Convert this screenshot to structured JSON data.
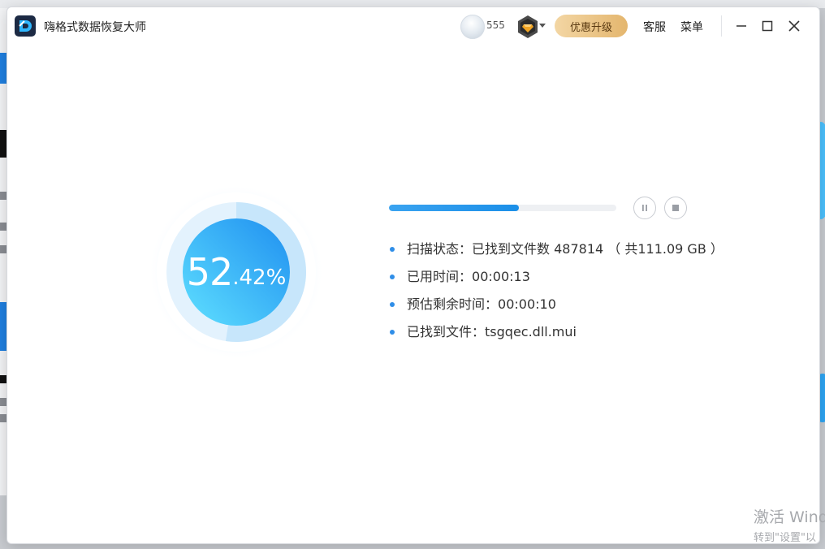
{
  "window": {
    "title": "嗨格式数据恢复大师"
  },
  "header": {
    "user_id": "555",
    "upgrade_label": "优惠升级",
    "service_label": "客服",
    "menu_label": "菜单"
  },
  "progress": {
    "percent_int": "52",
    "percent_dec": ".42%",
    "fraction": 0.5242,
    "bar_fraction": 0.57
  },
  "info": {
    "scan_label": "扫描状态：",
    "scan_value": "已找到文件数 487814 （ 共111.09 GB ）",
    "elapsed_label": "已用时间：",
    "elapsed_value": "00:00:13",
    "remaining_label": "预估剩余时间：",
    "remaining_value": "00:00:10",
    "found_label": "已找到文件：",
    "found_value": "tsgqec.dll.mui"
  },
  "watermark": {
    "line1": "激活 Wind",
    "line2": "转到\"设置\"以"
  },
  "colors": {
    "accent": "#1b8fe8",
    "circle_gradient_start": "#2aa6f5",
    "circle_gradient_end": "#5fd7ff",
    "upgrade_gold": "#e4b66e"
  },
  "icons": [
    "app-logo-icon",
    "vip-badge-icon",
    "minimize-icon",
    "maximize-icon",
    "close-icon",
    "pause-icon",
    "stop-icon"
  ]
}
